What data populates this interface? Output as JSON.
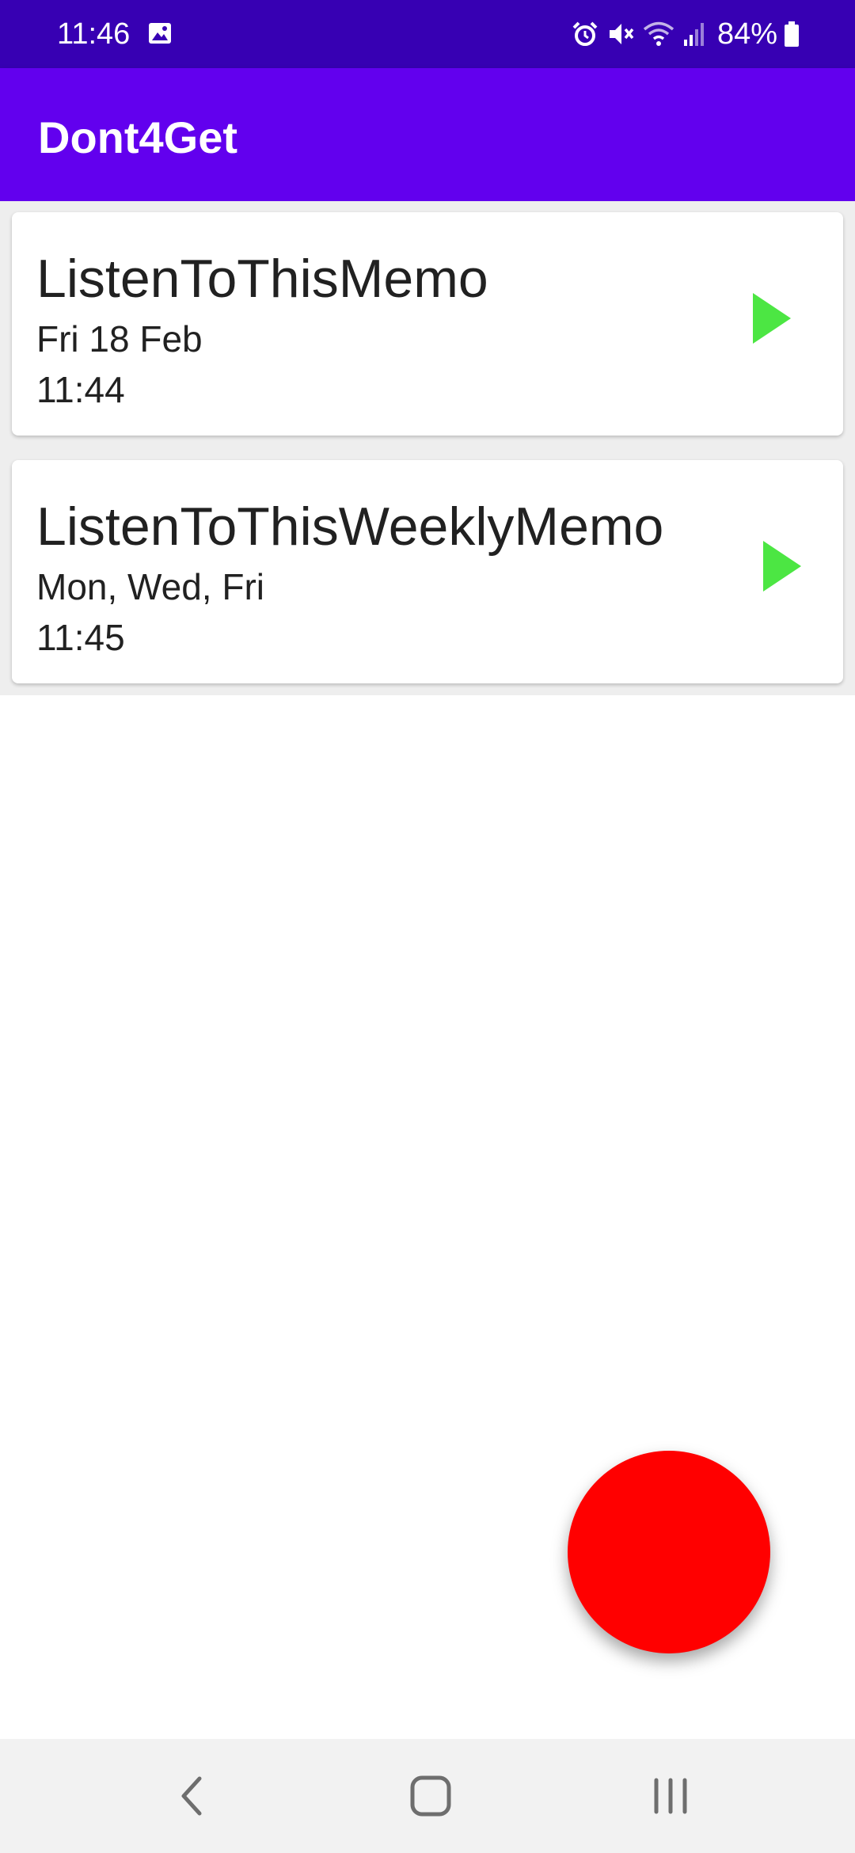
{
  "status_bar": {
    "time": "11:46",
    "battery_percent": "84%",
    "icons": [
      "gallery-icon",
      "alarm-icon",
      "mute-icon",
      "wifi-icon",
      "signal-icon",
      "battery-icon"
    ]
  },
  "app_bar": {
    "title": "Dont4Get"
  },
  "memos": [
    {
      "title": "ListenToThisMemo",
      "date": "Fri 18 Feb",
      "time": "11:44",
      "action_icon": "play-icon"
    },
    {
      "title": "ListenToThisWeeklyMemo",
      "date": "Mon, Wed, Fri",
      "time": "11:45",
      "action_icon": "play-icon"
    }
  ],
  "fab": {
    "icon": "record-button",
    "color": "#ff0000"
  },
  "nav_bar": {
    "buttons": [
      "back-icon",
      "home-icon",
      "recents-icon"
    ]
  },
  "colors": {
    "status_bar": "#3700b3",
    "app_bar": "#6200ee",
    "play": "#4ce643",
    "record": "#ff0000"
  }
}
